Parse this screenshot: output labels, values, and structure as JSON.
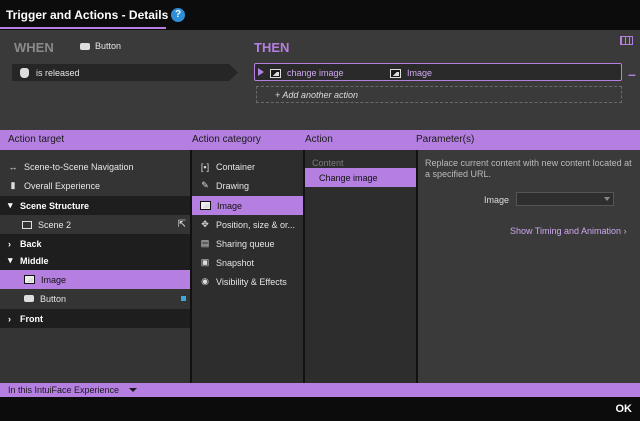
{
  "window": {
    "title": "Trigger and Actions - Details",
    "help": "?"
  },
  "rule": {
    "when_label": "WHEN",
    "when_source": "Button",
    "trigger": "is released",
    "then_label": "THEN",
    "action_name": "change image",
    "action_target": "Image",
    "add_action": "+ Add another action"
  },
  "columns": {
    "target": "Action target",
    "category": "Action category",
    "action": "Action",
    "params": "Parameter(s)"
  },
  "targets": [
    {
      "label": "Scene-to-Scene Navigation",
      "icon": "navigation-icon"
    },
    {
      "label": "Overall Experience",
      "icon": "experience-icon"
    },
    {
      "label": "Scene Structure",
      "group": true
    },
    {
      "label": "Scene 2",
      "icon": "scene-icon"
    },
    {
      "label": "Back",
      "group": true
    },
    {
      "label": "Middle",
      "group": true
    },
    {
      "label": "Image",
      "icon": "image-icon",
      "selected": true
    },
    {
      "label": "Button",
      "icon": "button-icon"
    },
    {
      "label": "Front",
      "group": true
    }
  ],
  "categories": [
    {
      "label": "Container",
      "icon": "container-icon"
    },
    {
      "label": "Drawing",
      "icon": "pen-icon"
    },
    {
      "label": "Image",
      "icon": "image-icon",
      "selected": true
    },
    {
      "label": "Position, size & or...",
      "icon": "move-icon"
    },
    {
      "label": "Sharing queue",
      "icon": "queue-icon"
    },
    {
      "label": "Snapshot",
      "icon": "snapshot-icon"
    },
    {
      "label": "Visibility & Effects",
      "icon": "eye-icon"
    }
  ],
  "actions": {
    "section": "Content",
    "selected": "Change image"
  },
  "parameters": {
    "description": "Replace current content with new content located at a specified URL.",
    "image_label": "Image",
    "image_value": "",
    "timing_link": "Show Timing and Animation"
  },
  "footer": {
    "scope": "In this IntuiFace Experience",
    "ok": "OK"
  },
  "colors": {
    "accent": "#b47fe0",
    "badge": "#3fa6e0"
  }
}
